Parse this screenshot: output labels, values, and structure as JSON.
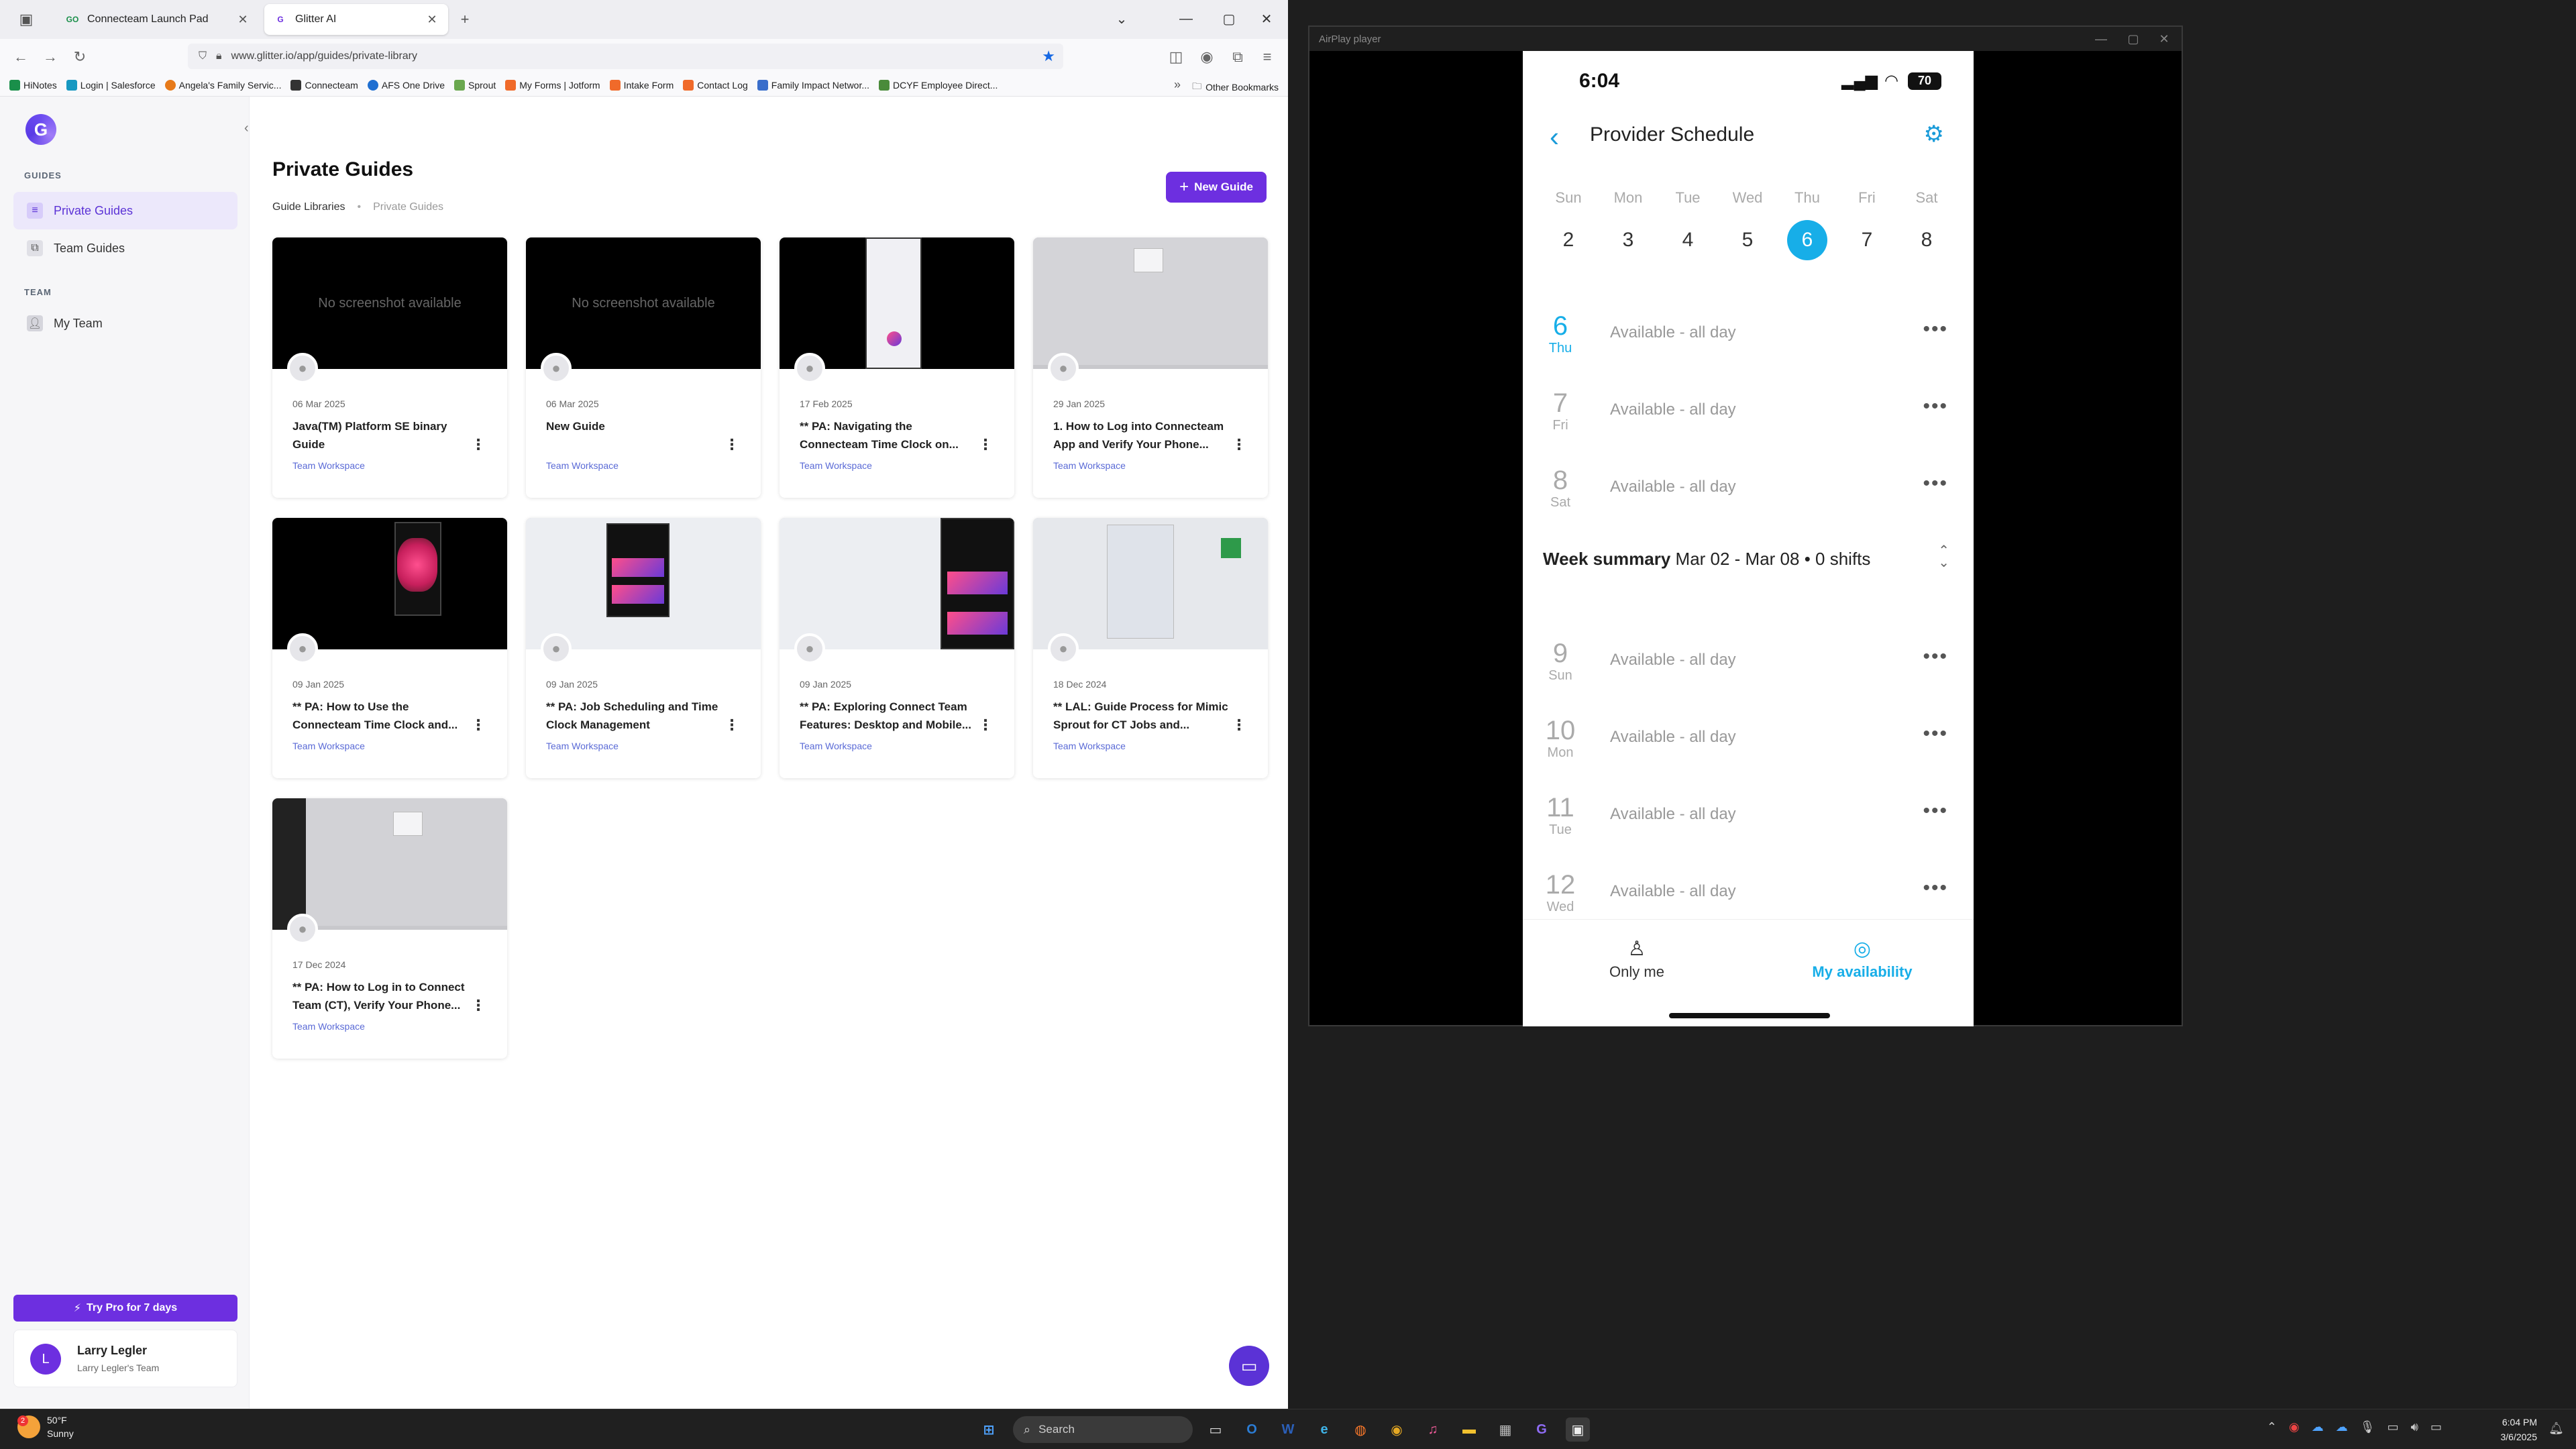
{
  "browser": {
    "tabs": [
      {
        "label": "Connecteam Launch Pad",
        "favicon": "GO",
        "active": false
      },
      {
        "label": "Glitter AI",
        "favicon": "G",
        "active": true
      }
    ],
    "url": "www.glitter.io/app/guides/private-library",
    "bookmarks": [
      {
        "label": "HiNotes",
        "color": "#1a8f4a"
      },
      {
        "label": "Login | Salesforce",
        "color": "#1798c1"
      },
      {
        "label": "Angela's Family Servic...",
        "color": "#e77a1a"
      },
      {
        "label": "Connecteam",
        "color": "#333333"
      },
      {
        "label": "AFS One Drive",
        "color": "#1f6fd1"
      },
      {
        "label": "Sprout",
        "color": "#6aa84f"
      },
      {
        "label": "My Forms | Jotform",
        "color": "#f06a2a"
      },
      {
        "label": "Intake Form",
        "color": "#f06a2a"
      },
      {
        "label": "Contact Log",
        "color": "#f06a2a"
      },
      {
        "label": "Family Impact Networ...",
        "color": "#3a6ecb"
      },
      {
        "label": "DCYF Employee Direct...",
        "color": "#4a8b3a"
      }
    ],
    "other_bookmarks": "Other Bookmarks"
  },
  "app": {
    "sidebar": {
      "guides_section": "GUIDES",
      "team_section": "TEAM",
      "items": [
        {
          "label": "Private Guides",
          "active": true
        },
        {
          "label": "Team Guides",
          "active": false
        },
        {
          "label": "My Team",
          "active": false
        }
      ],
      "try_pro": "Try Pro for 7 days",
      "user": {
        "initial": "L",
        "name": "Larry Legler",
        "team": "Larry Legler's Team"
      }
    },
    "page_title": "Private Guides",
    "breadcrumb": {
      "root": "Guide Libraries",
      "current": "Private Guides"
    },
    "new_guide": "New Guide",
    "no_screenshot": "No screenshot available",
    "cards": [
      {
        "date": "06 Mar 2025",
        "title": "Java(TM) Platform SE binary Guide",
        "workspace": "Team Workspace"
      },
      {
        "date": "06 Mar 2025",
        "title": "New Guide",
        "workspace": "Team Workspace"
      },
      {
        "date": "17 Feb 2025",
        "title": "** PA: Navigating the Connecteam Time Clock on...",
        "workspace": "Team Workspace"
      },
      {
        "date": "29 Jan 2025",
        "title": "1. How to Log into Connecteam App and Verify Your Phone...",
        "workspace": "Team Workspace"
      },
      {
        "date": "09 Jan 2025",
        "title": "** PA: How to Use the Connecteam Time Clock and...",
        "workspace": "Team Workspace"
      },
      {
        "date": "09 Jan 2025",
        "title": "** PA: Job Scheduling and Time Clock Management",
        "workspace": "Team Workspace"
      },
      {
        "date": "09 Jan 2025",
        "title": "** PA: Exploring Connect Team Features: Desktop and Mobile...",
        "workspace": "Team Workspace"
      },
      {
        "date": "18 Dec 2024",
        "title": "** LAL: Guide Process for Mimic Sprout for CT Jobs and...",
        "workspace": "Team Workspace"
      },
      {
        "date": "17 Dec 2024",
        "title": "** PA: How to Log in to Connect Team (CT), Verify Your Phone...",
        "workspace": "Team Workspace"
      }
    ]
  },
  "airplay": {
    "window_title": "AirPlay player",
    "phone": {
      "time": "6:04",
      "battery": "70",
      "title": "Provider Schedule",
      "week_days": [
        "Sun",
        "Mon",
        "Tue",
        "Wed",
        "Thu",
        "Fri",
        "Sat"
      ],
      "week_dates": [
        "2",
        "3",
        "4",
        "5",
        "6",
        "7",
        "8"
      ],
      "selected_date": "6",
      "rows_top": [
        {
          "num": "6",
          "day": "Thu",
          "text": "Available -  all day",
          "today": true
        },
        {
          "num": "7",
          "day": "Fri",
          "text": "Available -  all day",
          "today": false
        },
        {
          "num": "8",
          "day": "Sat",
          "text": "Available -  all day",
          "today": false
        }
      ],
      "week_summary": {
        "label": "Week summary",
        "detail": "Mar 02 - Mar 08 • 0 shifts"
      },
      "rows_bottom": [
        {
          "num": "9",
          "day": "Sun",
          "text": "Available -  all day",
          "today": false
        },
        {
          "num": "10",
          "day": "Mon",
          "text": "Available -  all day",
          "today": false
        },
        {
          "num": "11",
          "day": "Tue",
          "text": "Available -  all day",
          "today": false
        },
        {
          "num": "12",
          "day": "Wed",
          "text": "Available -  all day",
          "today": false
        }
      ],
      "tabs": [
        {
          "label": "Only me",
          "active": false
        },
        {
          "label": "My availability",
          "active": true
        }
      ],
      "accent": "#17aee8"
    }
  },
  "taskbar": {
    "weather": {
      "temp": "50°F",
      "condition": "Sunny",
      "badge": "2"
    },
    "search": "Search",
    "clock_time": "6:04 PM",
    "clock_date": "3/6/2025"
  }
}
